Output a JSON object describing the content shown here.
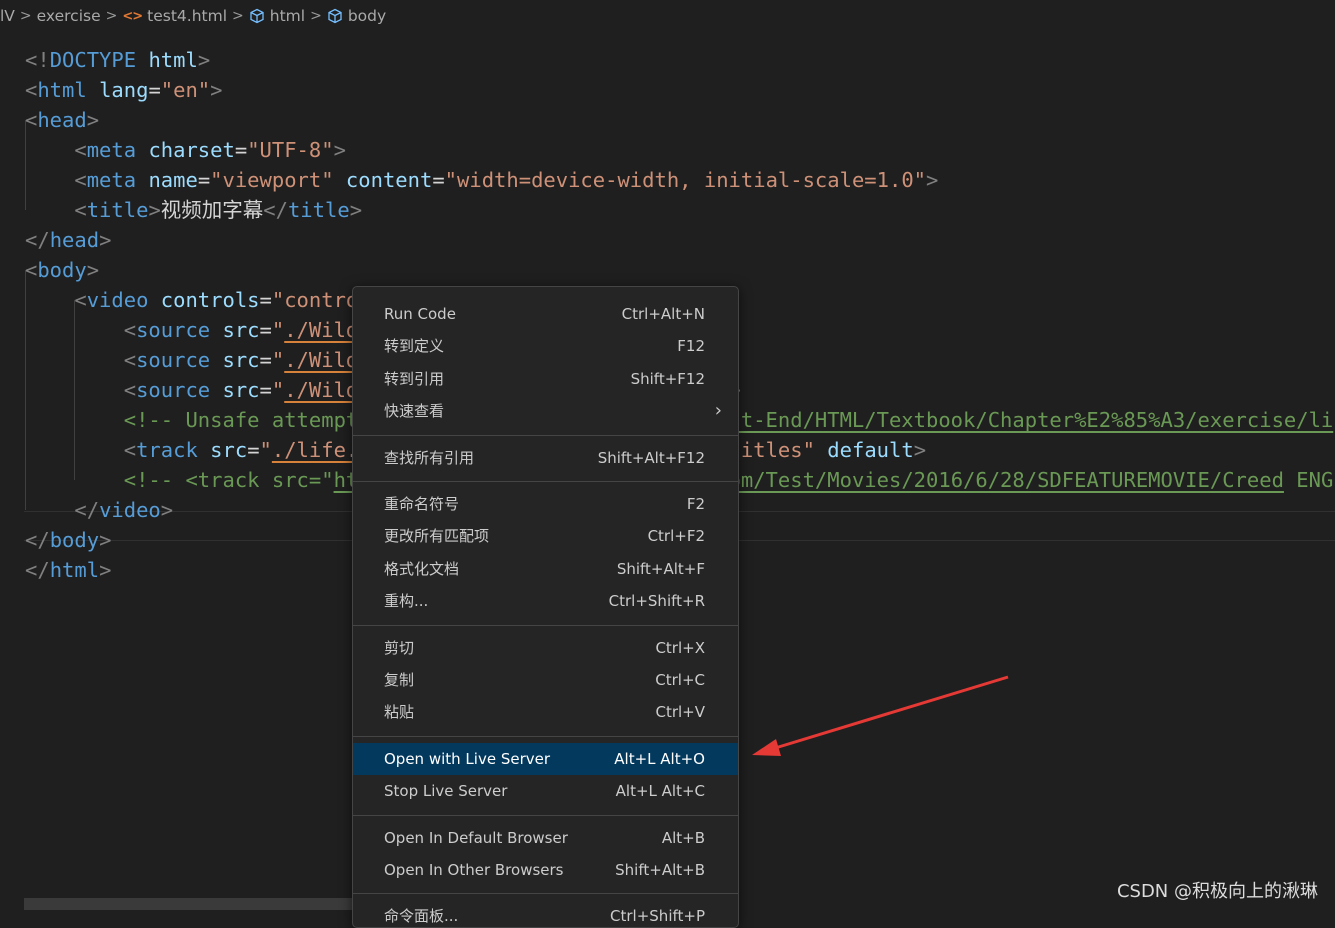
{
  "breadcrumb": {
    "items": [
      "lV",
      "exercise",
      "test4.html",
      "html",
      "body"
    ]
  },
  "editor": {
    "lines": [
      [
        {
          "t": "br",
          "v": "<!"
        },
        {
          "t": "tag",
          "v": "DOCTYPE"
        },
        {
          "t": "txt",
          "v": " "
        },
        {
          "t": "attr",
          "v": "html"
        },
        {
          "t": "br",
          "v": ">"
        }
      ],
      [
        {
          "t": "br",
          "v": "<"
        },
        {
          "t": "tag",
          "v": "html"
        },
        {
          "t": "txt",
          "v": " "
        },
        {
          "t": "attr",
          "v": "lang"
        },
        {
          "t": "txt",
          "v": "="
        },
        {
          "t": "str",
          "v": "\"en\""
        },
        {
          "t": "br",
          "v": ">"
        }
      ],
      [
        {
          "t": "br",
          "v": "<"
        },
        {
          "t": "tag",
          "v": "head"
        },
        {
          "t": "br",
          "v": ">"
        }
      ],
      [
        {
          "t": "txt",
          "v": "    "
        },
        {
          "t": "br",
          "v": "<"
        },
        {
          "t": "tag",
          "v": "meta"
        },
        {
          "t": "txt",
          "v": " "
        },
        {
          "t": "attr",
          "v": "charset"
        },
        {
          "t": "txt",
          "v": "="
        },
        {
          "t": "str",
          "v": "\"UTF-8\""
        },
        {
          "t": "br",
          "v": ">"
        }
      ],
      [
        {
          "t": "txt",
          "v": "    "
        },
        {
          "t": "br",
          "v": "<"
        },
        {
          "t": "tag",
          "v": "meta"
        },
        {
          "t": "txt",
          "v": " "
        },
        {
          "t": "attr",
          "v": "name"
        },
        {
          "t": "txt",
          "v": "="
        },
        {
          "t": "str",
          "v": "\"viewport\""
        },
        {
          "t": "txt",
          "v": " "
        },
        {
          "t": "attr",
          "v": "content"
        },
        {
          "t": "txt",
          "v": "="
        },
        {
          "t": "str",
          "v": "\"width=device-width, initial-scale=1.0\""
        },
        {
          "t": "br",
          "v": ">"
        }
      ],
      [
        {
          "t": "txt",
          "v": "    "
        },
        {
          "t": "br",
          "v": "<"
        },
        {
          "t": "tag",
          "v": "title"
        },
        {
          "t": "br",
          "v": ">"
        },
        {
          "t": "txt",
          "v": "视频加字幕"
        },
        {
          "t": "br",
          "v": "</"
        },
        {
          "t": "tag",
          "v": "title"
        },
        {
          "t": "br",
          "v": ">"
        }
      ],
      [
        {
          "t": "br",
          "v": "</"
        },
        {
          "t": "tag",
          "v": "head"
        },
        {
          "t": "br",
          "v": ">"
        }
      ],
      [
        {
          "t": "br",
          "v": "<"
        },
        {
          "t": "tag",
          "v": "body"
        },
        {
          "t": "br",
          "v": ">"
        }
      ],
      [
        {
          "t": "txt",
          "v": "    "
        },
        {
          "t": "br",
          "v": "<"
        },
        {
          "t": "tag",
          "v": "video"
        },
        {
          "t": "txt",
          "v": " "
        },
        {
          "t": "attr",
          "v": "controls"
        },
        {
          "t": "txt",
          "v": "="
        },
        {
          "t": "str",
          "v": "\"controls\""
        },
        {
          "t": "br",
          "v": ">"
        }
      ],
      [
        {
          "t": "txt",
          "v": "        "
        },
        {
          "t": "br",
          "v": "<"
        },
        {
          "t": "tag",
          "v": "source"
        },
        {
          "t": "txt",
          "v": " "
        },
        {
          "t": "attr",
          "v": "src"
        },
        {
          "t": "txt",
          "v": "="
        },
        {
          "t": "str",
          "v": "\""
        },
        {
          "t": "str",
          "v": "./Wild",
          "u": "warn"
        }
      ],
      [
        {
          "t": "txt",
          "v": "        "
        },
        {
          "t": "br",
          "v": "<"
        },
        {
          "t": "tag",
          "v": "source"
        },
        {
          "t": "txt",
          "v": " "
        },
        {
          "t": "attr",
          "v": "src"
        },
        {
          "t": "txt",
          "v": "="
        },
        {
          "t": "str",
          "v": "\""
        },
        {
          "t": "str",
          "v": "./Wild",
          "u": "warn"
        }
      ],
      [
        {
          "t": "txt",
          "v": "        "
        },
        {
          "t": "br",
          "v": "<"
        },
        {
          "t": "tag",
          "v": "source"
        },
        {
          "t": "txt",
          "v": " "
        },
        {
          "t": "attr",
          "v": "src"
        },
        {
          "t": "txt",
          "v": "="
        },
        {
          "t": "str",
          "v": "\""
        },
        {
          "t": "str",
          "v": "./Wild",
          "u": "warn"
        },
        {
          "t": "txt",
          "v": "                              "
        },
        {
          "t": "br",
          "v": ">"
        }
      ],
      [
        {
          "t": "txt",
          "v": "        "
        },
        {
          "t": "com",
          "v": "<!-- Unsafe attempt                              "
        },
        {
          "t": "com",
          "v": "nt-End/HTML/Textbook/Chapter%E2%85%A3/exercise/li",
          "u": "link"
        }
      ],
      [
        {
          "t": "txt",
          "v": "        "
        },
        {
          "t": "br",
          "v": "<"
        },
        {
          "t": "tag",
          "v": "track"
        },
        {
          "t": "txt",
          "v": " "
        },
        {
          "t": "attr",
          "v": "src"
        },
        {
          "t": "txt",
          "v": "="
        },
        {
          "t": "str",
          "v": "\""
        },
        {
          "t": "str",
          "v": "./life.",
          "u": "warn"
        },
        {
          "t": "txt",
          "v": "                              "
        },
        {
          "t": "str",
          "v": "titles\""
        },
        {
          "t": "txt",
          "v": " "
        },
        {
          "t": "attr",
          "v": "default"
        },
        {
          "t": "br",
          "v": ">"
        }
      ],
      [
        {
          "t": "txt",
          "v": "        "
        },
        {
          "t": "com",
          "v": "<!-- <track src=\""
        },
        {
          "t": "com",
          "v": "ht",
          "u": "link"
        },
        {
          "t": "txt",
          "v": "                              "
        },
        {
          "t": "com",
          "v": "om/Test/Movies/2016/6/28/SDFEATUREMOVIE/Creed",
          "u": "link"
        },
        {
          "t": "com",
          "v": " ENG"
        }
      ],
      [
        {
          "t": "txt",
          "v": "    "
        },
        {
          "t": "br",
          "v": "</"
        },
        {
          "t": "tag",
          "v": "video"
        },
        {
          "t": "br",
          "v": ">"
        }
      ],
      [
        {
          "t": "br",
          "v": "</"
        },
        {
          "t": "tag",
          "v": "body"
        },
        {
          "t": "br",
          "v": ">"
        }
      ],
      [
        {
          "t": "br",
          "v": "</"
        },
        {
          "t": "tag",
          "v": "html"
        },
        {
          "t": "br",
          "v": ">"
        }
      ]
    ]
  },
  "context_menu": {
    "groups": [
      [
        {
          "label": "Run Code",
          "shortcut": "Ctrl+Alt+N"
        },
        {
          "label": "转到定义",
          "shortcut": "F12"
        },
        {
          "label": "转到引用",
          "shortcut": "Shift+F12"
        },
        {
          "label": "快速查看",
          "shortcut": "",
          "submenu": true
        }
      ],
      [
        {
          "label": "查找所有引用",
          "shortcut": "Shift+Alt+F12"
        }
      ],
      [
        {
          "label": "重命名符号",
          "shortcut": "F2"
        },
        {
          "label": "更改所有匹配项",
          "shortcut": "Ctrl+F2"
        },
        {
          "label": "格式化文档",
          "shortcut": "Shift+Alt+F"
        },
        {
          "label": "重构...",
          "shortcut": "Ctrl+Shift+R"
        }
      ],
      [
        {
          "label": "剪切",
          "shortcut": "Ctrl+X"
        },
        {
          "label": "复制",
          "shortcut": "Ctrl+C"
        },
        {
          "label": "粘贴",
          "shortcut": "Ctrl+V"
        }
      ],
      [
        {
          "label": "Open with Live Server",
          "shortcut": "Alt+L Alt+O",
          "active": true
        },
        {
          "label": "Stop Live Server",
          "shortcut": "Alt+L Alt+C"
        }
      ],
      [
        {
          "label": "Open In Default Browser",
          "shortcut": "Alt+B"
        },
        {
          "label": "Open In Other Browsers",
          "shortcut": "Shift+Alt+B"
        }
      ],
      [
        {
          "label": "命令面板...",
          "shortcut": "Ctrl+Shift+P"
        }
      ]
    ]
  },
  "watermark": "CSDN @积极向上的湫琳",
  "colors": {
    "background": "#1f1f1f",
    "menu_background": "#252526",
    "menu_highlight": "#04395e",
    "arrow": "#e53935",
    "tag": "#569cd6",
    "attribute": "#9cdcfe",
    "string": "#ce9178",
    "comment": "#6a9955"
  }
}
